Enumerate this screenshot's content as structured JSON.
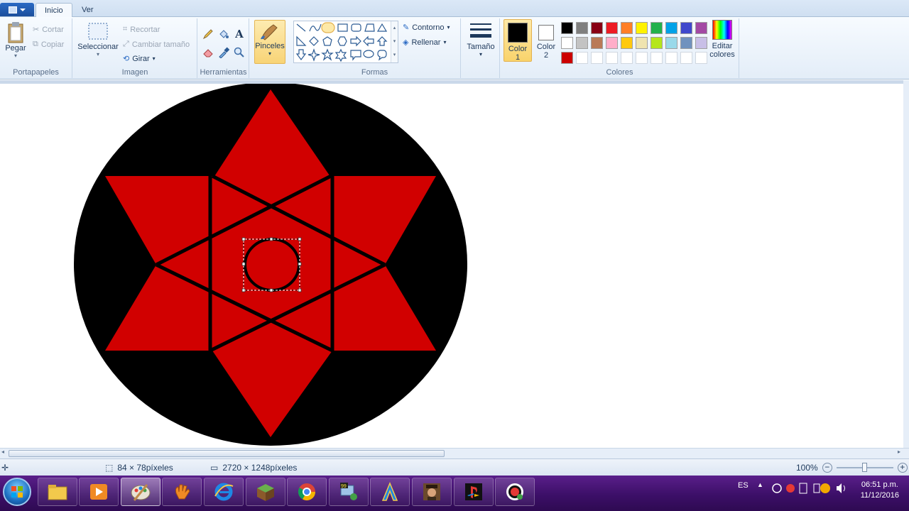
{
  "tabs": {
    "home": "Inicio",
    "view": "Ver"
  },
  "clipboard": {
    "paste": "Pegar",
    "cut": "Cortar",
    "copy": "Copiar",
    "group": "Portapapeles"
  },
  "image": {
    "select": "Seleccionar",
    "crop": "Recortar",
    "resize": "Cambiar tamaño",
    "rotate": "Girar",
    "group": "Imagen"
  },
  "tools": {
    "group": "Herramientas"
  },
  "brushes": {
    "label": "Pinceles"
  },
  "shapes": {
    "outline": "Contorno",
    "fill": "Rellenar",
    "group": "Formas"
  },
  "size": {
    "label": "Tamaño"
  },
  "colors": {
    "color1": "Color\n1",
    "color1_l1": "Color",
    "color1_l2": "1",
    "color2_l1": "Color",
    "color2_l2": "2",
    "color1_value": "#000000",
    "color2_value": "#ffffff",
    "edit_l1": "Editar",
    "edit_l2": "colores",
    "group": "Colores",
    "palette_row1": [
      "#000000",
      "#7f7f7f",
      "#880015",
      "#ed1c24",
      "#ff7f27",
      "#fff200",
      "#22b14c",
      "#00a2e8",
      "#3f48cc",
      "#a349a4"
    ],
    "palette_row2": [
      "#ffffff",
      "#c3c3c3",
      "#b97a57",
      "#ffaec9",
      "#ffc90e",
      "#efe4b0",
      "#b5e61d",
      "#99d9ea",
      "#7092be",
      "#c8bfe7"
    ],
    "palette_row3": [
      "#cc0000",
      "#ffffff",
      "#ffffff",
      "#ffffff",
      "#ffffff",
      "#ffffff",
      "#ffffff",
      "#ffffff",
      "#ffffff",
      "#ffffff"
    ]
  },
  "drawing": {
    "background": "#000000",
    "star": "#d10000",
    "lines": "#000000"
  },
  "status": {
    "selection": "84 × 78píxeles",
    "image_size": "2720 × 1248píxeles",
    "zoom": "100%"
  },
  "tray": {
    "lang": "ES",
    "time": "06:51 p.m.",
    "date": "11/12/2016"
  }
}
